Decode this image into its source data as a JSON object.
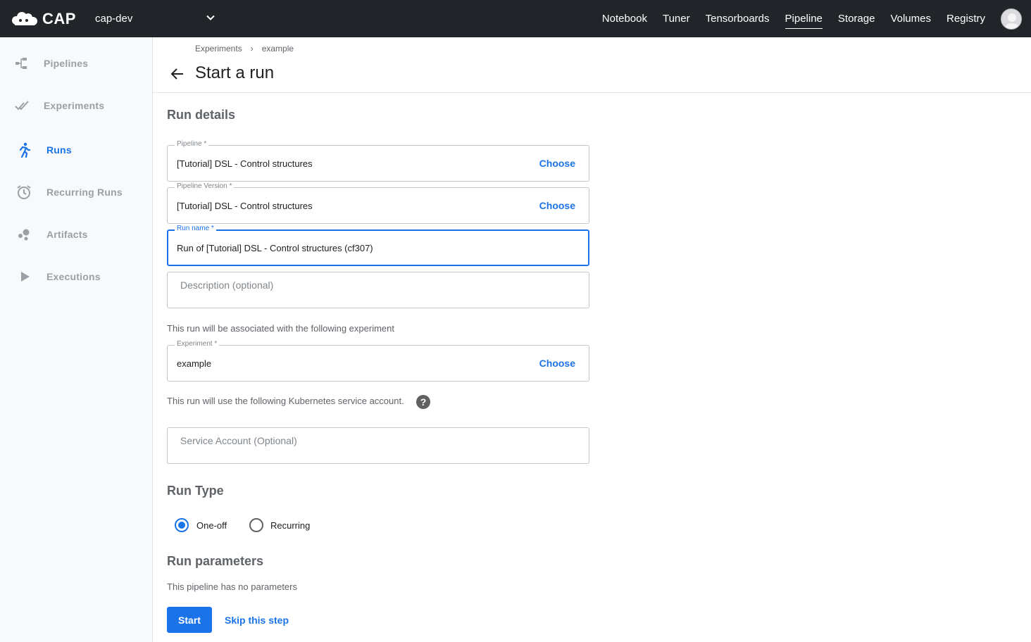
{
  "app": {
    "logo_text": "CAP",
    "namespace": "cap-dev"
  },
  "topnav": [
    "Notebook",
    "Tuner",
    "Tensorboards",
    "Pipeline",
    "Storage",
    "Volumes",
    "Registry"
  ],
  "topnav_active": "Pipeline",
  "sidebar": {
    "items": [
      {
        "label": "Pipelines",
        "icon": "pipelines-icon"
      },
      {
        "label": "Experiments",
        "icon": "experiments-icon"
      },
      {
        "label": "Runs",
        "icon": "runs-icon",
        "active": true
      },
      {
        "label": "Recurring Runs",
        "icon": "alarm-clock-icon"
      },
      {
        "label": "Artifacts",
        "icon": "artifacts-icon"
      },
      {
        "label": "Executions",
        "icon": "play-icon"
      }
    ]
  },
  "breadcrumb": {
    "parent": "Experiments",
    "separator": "›",
    "current": "example"
  },
  "page_title": "Start a run",
  "run_details": {
    "title": "Run details",
    "pipeline": {
      "label": "Pipeline *",
      "value": "[Tutorial] DSL - Control structures",
      "action": "Choose"
    },
    "pipeline_version": {
      "label": "Pipeline Version *",
      "value": "[Tutorial] DSL - Control structures",
      "action": "Choose"
    },
    "run_name": {
      "label": "Run name *",
      "value": "Run of [Tutorial] DSL - Control structures (cf307)"
    },
    "description": {
      "placeholder": "Description (optional)"
    },
    "experiment_note": "This run will be associated with the following experiment",
    "experiment": {
      "label": "Experiment *",
      "value": "example",
      "action": "Choose"
    },
    "service_account_note": "This run will use the following Kubernetes service account.",
    "service_account": {
      "placeholder": "Service Account (Optional)"
    },
    "help_symbol": "?"
  },
  "run_type": {
    "title": "Run Type",
    "options": [
      "One-off",
      "Recurring"
    ],
    "selected": "One-off"
  },
  "run_parameters": {
    "title": "Run parameters",
    "note": "This pipeline has no parameters"
  },
  "actions": {
    "start": "Start",
    "skip": "Skip this step"
  },
  "colors": {
    "accent": "#1a73e8",
    "topbar": "#212529",
    "sidebar_bg": "#f8f9fa"
  }
}
